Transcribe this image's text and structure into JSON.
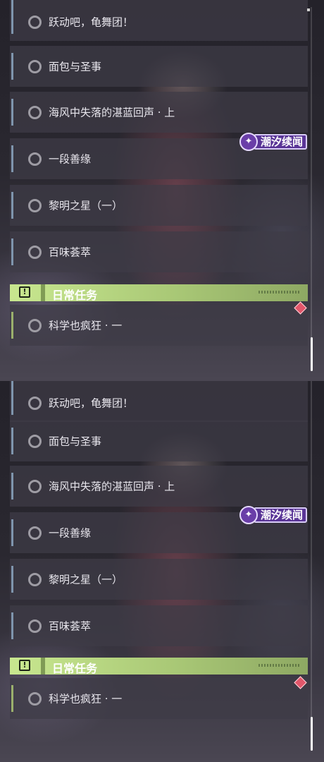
{
  "panels": [
    {
      "quests": [
        {
          "label": "跃动吧，龟舞团！"
        },
        {
          "label": "面包与圣事"
        },
        {
          "label": "海风中失落的湛蓝回声 · 上"
        },
        {
          "label": "一段善缘"
        },
        {
          "label": "黎明之星（一）"
        },
        {
          "label": "百味荟萃"
        }
      ],
      "section": {
        "title": "日常任务",
        "icon": "!"
      },
      "daily_quests": [
        {
          "label": "科学也疯狂 · 一"
        }
      ],
      "badge": {
        "text": "潮汐续闻",
        "icon": "tide-logo-icon"
      }
    },
    {
      "quests": [
        {
          "label": "跃动吧，龟舞团！"
        },
        {
          "label": "面包与圣事"
        },
        {
          "label": "海风中失落的湛蓝回声 · 上"
        },
        {
          "label": "一段善缘"
        },
        {
          "label": "黎明之星（一）"
        },
        {
          "label": "百味荟萃"
        }
      ],
      "section": {
        "title": "日常任务",
        "icon": "!"
      },
      "daily_quests": [
        {
          "label": "科学也疯狂 · 一"
        }
      ],
      "badge": {
        "text": "潮汐续闻",
        "icon": "tide-logo-icon"
      }
    }
  ],
  "colors": {
    "accent_daily": "#c8e78f",
    "badge_purple": "#5a3597",
    "quest_stripe": "#7f95ad",
    "notification": "#e1566a"
  }
}
